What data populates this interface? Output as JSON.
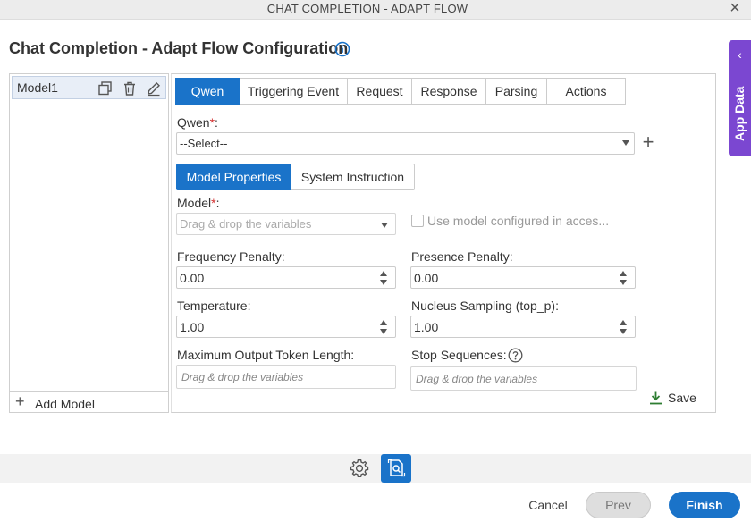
{
  "window": {
    "title": "CHAT COMPLETION - ADAPT FLOW"
  },
  "page": {
    "title": "Chat Completion - Adapt Flow Configuration"
  },
  "side_panel": {
    "label": "App Data"
  },
  "models": {
    "items": [
      {
        "label": "Model1"
      }
    ],
    "add_label": "Add Model"
  },
  "tabs": [
    {
      "label": "Qwen",
      "active": true
    },
    {
      "label": "Triggering Event"
    },
    {
      "label": "Request"
    },
    {
      "label": "Response"
    },
    {
      "label": "Parsing"
    },
    {
      "label": "Actions"
    }
  ],
  "qwen": {
    "label": "Qwen",
    "required_mark": "*",
    "label_suffix": ":",
    "select_value": "--Select--"
  },
  "subtabs": [
    {
      "label": "Model Properties",
      "active": true
    },
    {
      "label": "System Instruction"
    }
  ],
  "model_field": {
    "label": "Model",
    "required_mark": "*",
    "label_suffix": ":",
    "placeholder": "Drag & drop the variables",
    "checkbox_label": "Use model configured in acces..."
  },
  "frequency_penalty": {
    "label": "Frequency Penalty:",
    "value": "0.00"
  },
  "presence_penalty": {
    "label": "Presence Penalty:",
    "value": "0.00"
  },
  "temperature": {
    "label": "Temperature:",
    "value": "1.00"
  },
  "nucleus_sampling": {
    "label": "Nucleus Sampling (top_p):",
    "value": "1.00"
  },
  "max_tokens": {
    "label": "Maximum Output Token Length:",
    "placeholder": "Drag & drop the variables"
  },
  "stop_sequences": {
    "label": "Stop Sequences:",
    "placeholder": "Drag & drop the variables"
  },
  "save_label": "Save",
  "footer": {
    "cancel": "Cancel",
    "prev": "Prev",
    "finish": "Finish"
  },
  "colors": {
    "accent": "#1a73c9",
    "app_data": "#7b47d1",
    "required": "#d32f2f",
    "save_icon": "#2e7d32"
  },
  "icons": {
    "close": "close-icon",
    "info": "info-icon",
    "app_data_arrow": "chevron-left-icon",
    "copy": "copy-icon",
    "delete": "trash-icon",
    "edit": "pencil-icon",
    "add": "plus-icon",
    "help": "help-icon",
    "save": "download-icon",
    "settings": "gear-icon",
    "document": "document-search-icon"
  }
}
